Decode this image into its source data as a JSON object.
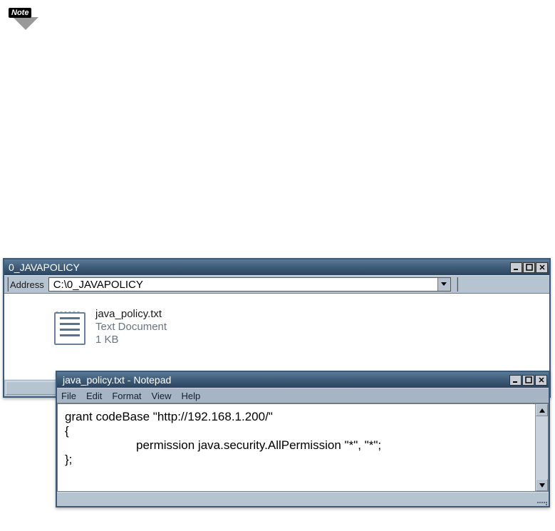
{
  "note": {
    "label": "Note"
  },
  "explorer": {
    "title": "0_JAVAPOLICY",
    "address_label": "Address",
    "address_value": "C:\\0_JAVAPOLICY",
    "file": {
      "name": "java_policy.txt",
      "type": "Text Document",
      "size": "1 KB"
    }
  },
  "notepad": {
    "title": "java_policy.txt  -  Notepad",
    "menu": {
      "file": "File",
      "edit": "Edit",
      "format": "Format",
      "view": "View",
      "help": "Help"
    },
    "content": {
      "line1": "grant codeBase \"http://192.168.1.200/\"",
      "line2": "{",
      "line3": "permission java.security.AllPermission \"*\", \"*\";",
      "line4": "};"
    }
  }
}
